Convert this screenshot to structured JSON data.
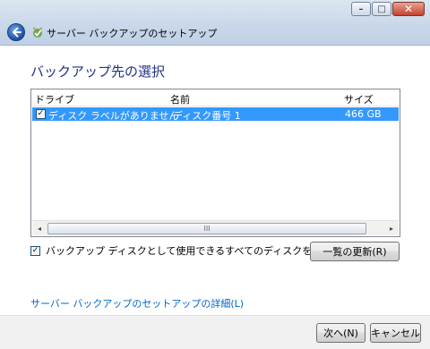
{
  "window": {
    "title": "サーバー バックアップのセットアップ",
    "minimize_glyph": "–",
    "maximize_glyph": "□",
    "close_glyph": "✕"
  },
  "page": {
    "heading": "バックアップ先の選択"
  },
  "disk_table": {
    "columns": [
      "ドライブ",
      "名前",
      "サイズ"
    ],
    "rows": [
      {
        "checked": true,
        "drive": "ディスク ラベルがありません",
        "name": "ディスク番号 1",
        "size": "466 GB"
      }
    ]
  },
  "scrollbar": {
    "left_glyph": "◂",
    "right_glyph": "▸",
    "grip": "III"
  },
  "show_all": {
    "checked": true,
    "label": "バックアップ ディスクとして使用できるすべてのディスクを表示する(S)"
  },
  "buttons": {
    "refresh": "一覧の更新(R)",
    "next": "次へ(N)",
    "cancel": "キャンセル"
  },
  "details_link": "サーバー バックアップのセットアップの詳細(L)",
  "colors": {
    "heading": "#1e3287",
    "selection": "#3399ff",
    "link": "#0066cc"
  }
}
